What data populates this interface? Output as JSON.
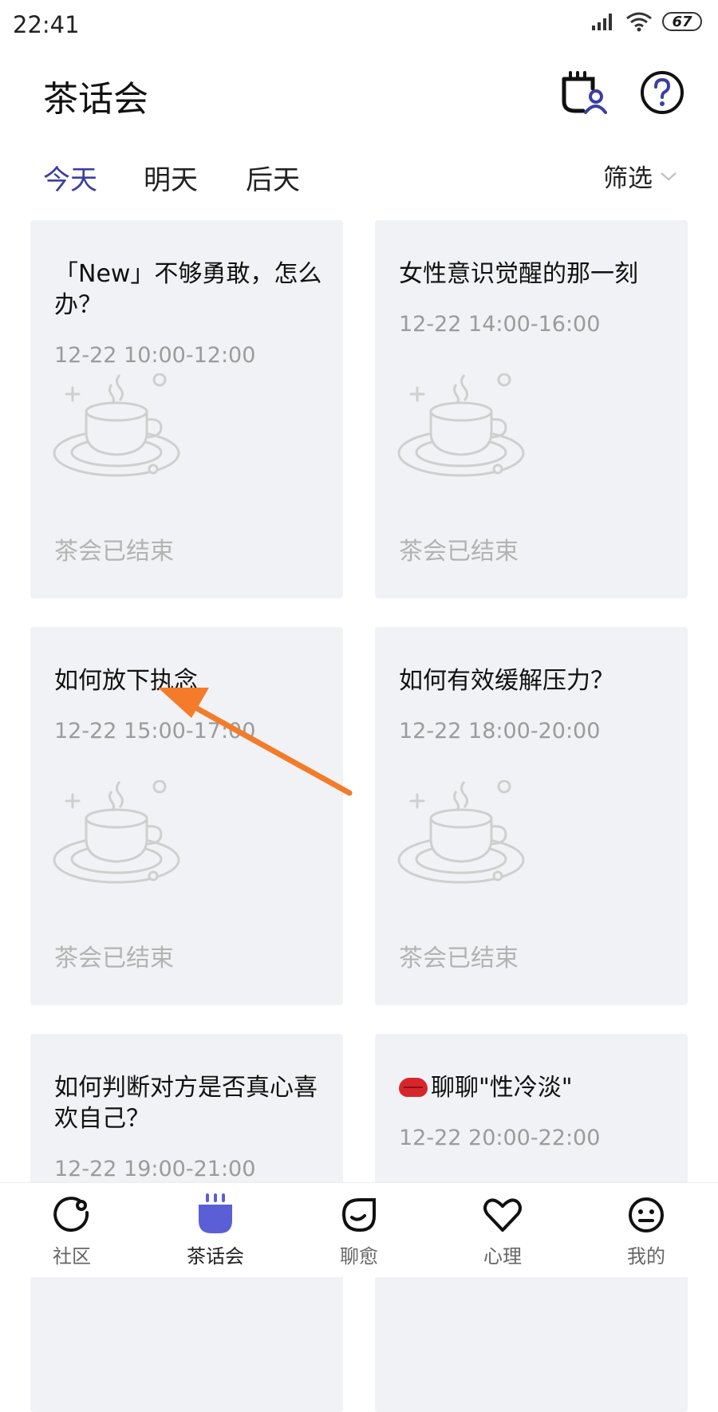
{
  "status_bar": {
    "time": "22:41",
    "battery": "67"
  },
  "header": {
    "title": "茶话会",
    "my_tea_icon": "tea-cup-user-icon",
    "help_icon": "question-icon"
  },
  "tabs": [
    {
      "label": "今天",
      "active": true
    },
    {
      "label": "明天",
      "active": false
    },
    {
      "label": "后天",
      "active": false
    }
  ],
  "filter": {
    "label": "筛选"
  },
  "cards": [
    {
      "title": "「New」不够勇敢，怎么办？",
      "time": "12-22 10:00-12:00",
      "status": "茶会已结束"
    },
    {
      "title": "女性意识觉醒的那一刻",
      "time": "12-22 14:00-16:00",
      "status": "茶会已结束"
    },
    {
      "title": "如何放下执念",
      "time": "12-22 15:00-17:00",
      "status": "茶会已结束"
    },
    {
      "title": "如何有效缓解压力？",
      "time": "12-22 18:00-20:00",
      "status": "茶会已结束"
    },
    {
      "title": "如何判断对方是否真心喜欢自己？",
      "time": "12-22 19:00-21:00"
    },
    {
      "title": "聊聊\"性冷淡\"",
      "time": "12-22 20:00-22:00",
      "emoji": "lips-icon"
    }
  ],
  "bottom_nav": [
    {
      "label": "社区",
      "icon": "community-icon",
      "active": false
    },
    {
      "label": "茶话会",
      "icon": "tea-party-icon",
      "active": true
    },
    {
      "label": "聊愈",
      "icon": "chat-heal-icon",
      "active": false
    },
    {
      "label": "心理",
      "icon": "heart-icon",
      "active": false
    },
    {
      "label": "我的",
      "icon": "smiley-icon",
      "active": false
    }
  ],
  "colors": {
    "accent": "#3c3fa0",
    "nav_active": "#5a5fd6",
    "card_bg": "#f1f2f5",
    "annotation": "#f47b2a"
  }
}
